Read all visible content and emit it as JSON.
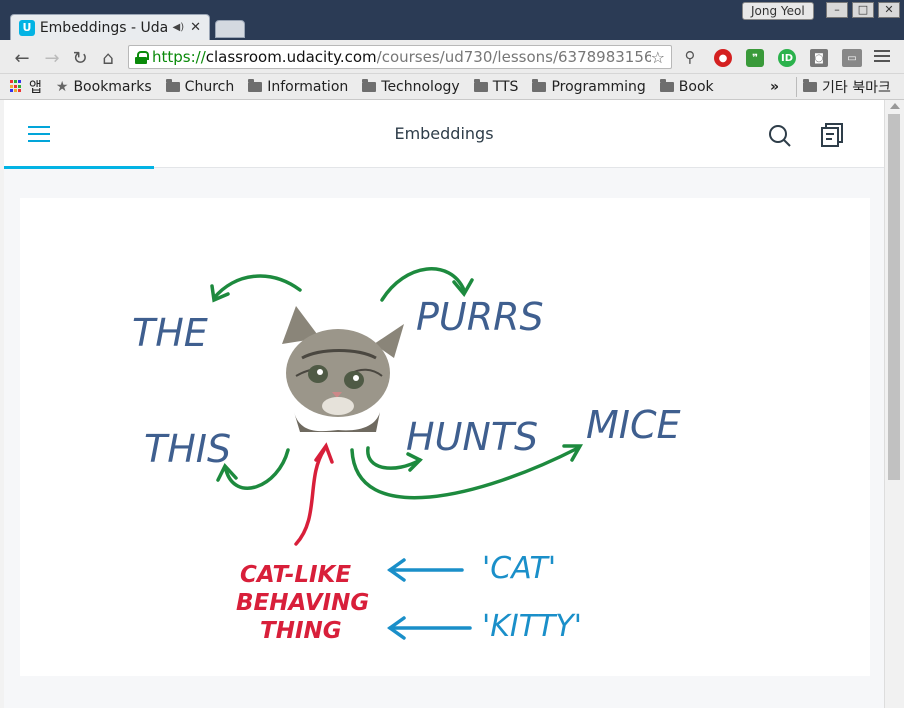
{
  "tab": {
    "title": "Embeddings - Uda",
    "favicon": "U"
  },
  "user": {
    "name": "Jong Yeol"
  },
  "address_bar": {
    "scheme": "https://",
    "host": "classroom.udacity.com",
    "path": "/courses/ud730/lessons/6378983156/co"
  },
  "bookmarks": {
    "apps_label": "앱",
    "items": [
      "Bookmarks",
      "Church",
      "Information",
      "Technology",
      "TTS",
      "Programming",
      "Book"
    ],
    "overflow": "»",
    "other": "기타 북마크"
  },
  "header": {
    "title": "Embeddings"
  },
  "lesson_progress": 0.17,
  "drawing": {
    "words": [
      "THE",
      "PURRS",
      "THIS",
      "HUNTS",
      "MICE"
    ],
    "concept_lines": [
      "CAT-LIKE",
      "BEHAVING",
      "THING"
    ],
    "synonyms": [
      "'CAT'",
      "'KITTY'"
    ],
    "colors": {
      "blue_words": "#3f5f8f",
      "green_arrows": "#1d8a3e",
      "red_concept": "#d81f3a",
      "cyan_synonyms": "#1a8fc9"
    }
  },
  "colors": {
    "accent": "#02b3e4",
    "tabstrip": "#2b3b55"
  }
}
